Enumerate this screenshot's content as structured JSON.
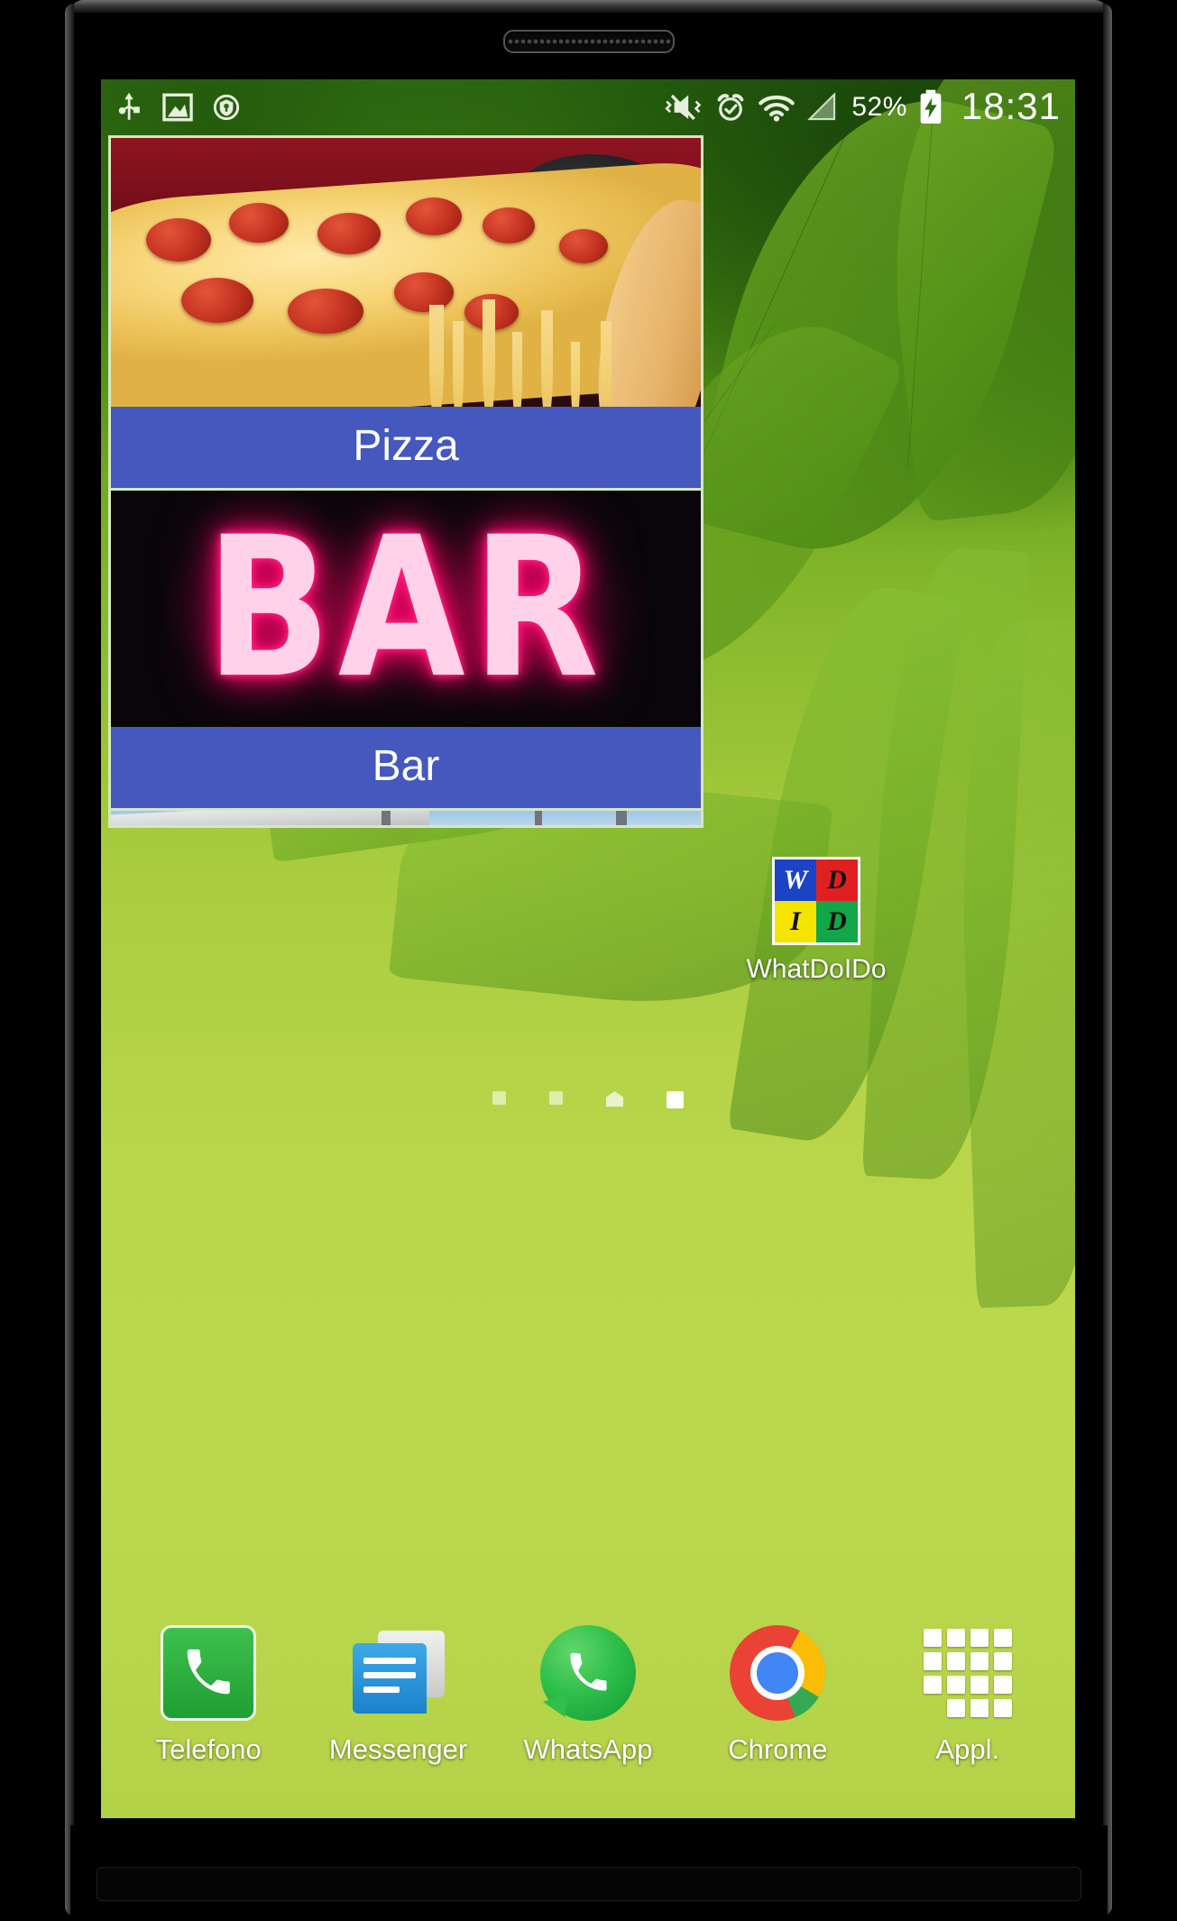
{
  "statusbar": {
    "left_icons": [
      {
        "name": "usb-icon",
        "label": "USB"
      },
      {
        "name": "screenshot-icon",
        "label": "Screenshot"
      },
      {
        "name": "security-shield-icon",
        "label": "Security"
      }
    ],
    "right_icons": [
      {
        "name": "vibrate-mute-icon",
        "label": "Sound off"
      },
      {
        "name": "alarm-icon",
        "label": "Alarm"
      },
      {
        "name": "wifi-icon",
        "label": "Wi-Fi"
      },
      {
        "name": "signal-icon",
        "label": "Signal"
      }
    ],
    "battery_percent": "52%",
    "time": "18:31"
  },
  "widget": {
    "name": "WhatDoIDo category list widget",
    "items": [
      {
        "label": "Pizza",
        "image": "pepperoni-pizza-photo"
      },
      {
        "label": "Bar",
        "image": "neon-bar-sign-photo"
      },
      {
        "label": "",
        "image": "station-canopy-photo"
      }
    ],
    "label_color": "#4458bd",
    "border_color": "#d7e7c0"
  },
  "bar_sign": {
    "text": "BAR"
  },
  "shortcut": {
    "label": "WhatDoIDo",
    "tiles": [
      {
        "letter": "W",
        "color": "#1b43c4"
      },
      {
        "letter": "D",
        "color": "#e02020"
      },
      {
        "letter": "I",
        "color": "#f5e400"
      },
      {
        "letter": "D",
        "color": "#12a54a"
      }
    ]
  },
  "page_indicator": {
    "count": 4,
    "active_index": 3,
    "home_index": 2
  },
  "dock": {
    "items": [
      {
        "label": "Telefono",
        "icon": "phone-icon"
      },
      {
        "label": "Messenger",
        "icon": "messages-icon"
      },
      {
        "label": "WhatsApp",
        "icon": "whatsapp-icon"
      },
      {
        "label": "Chrome",
        "icon": "chrome-icon"
      },
      {
        "label": "Appl.",
        "icon": "app-drawer-icon"
      }
    ]
  },
  "theme": {
    "wallpaper_top": "#2e6a10",
    "wallpaper_bottom": "#b4d248",
    "widget_label_blue": "#4458bd"
  }
}
